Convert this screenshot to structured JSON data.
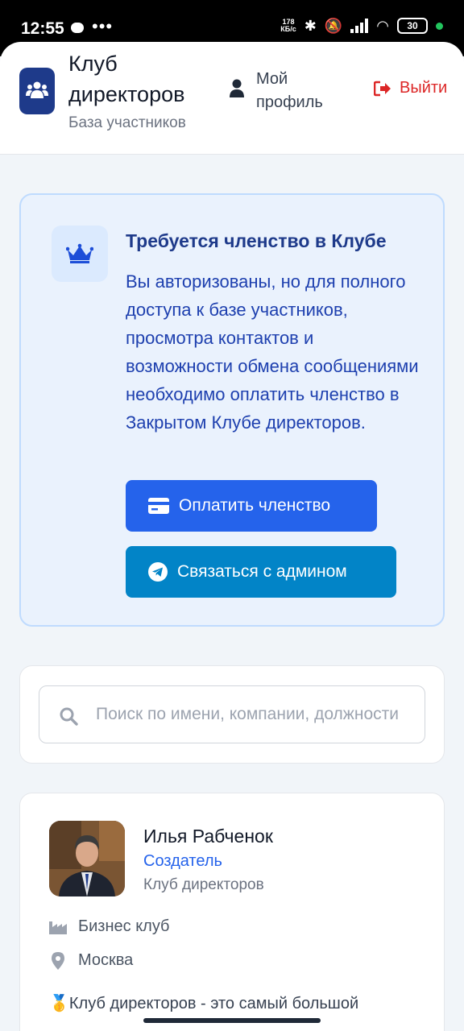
{
  "status_bar": {
    "time": "12:55",
    "net_speed_value": "178",
    "net_speed_unit": "КБ/с",
    "battery": "30"
  },
  "header": {
    "title": "Клуб директоров",
    "subtitle": "База участников",
    "profile_label": "Мой профиль",
    "logout_label": "Выйти",
    "logout_color": "#dc2626"
  },
  "membership": {
    "title": "Требуется членство в Клубе",
    "text": "Вы авторизованы, но для полного доступа к базе участников, просмотра контактов и возможности обмена сообщениями необходимо оплатить членство в Закрытом Клубе директоров.",
    "pay_button": "Оплатить членство",
    "admin_button": "Связаться с админом",
    "pay_color": "#2563eb",
    "admin_color": "#0284c7"
  },
  "search": {
    "placeholder": "Поиск по имени, компании, должности"
  },
  "member": {
    "name": "Илья Рабченок",
    "role": "Создатель",
    "company": "Клуб директоров",
    "industry": "Бизнес клуб",
    "city": "Москва",
    "about": "🥇Клуб директоров - это самый большой"
  }
}
